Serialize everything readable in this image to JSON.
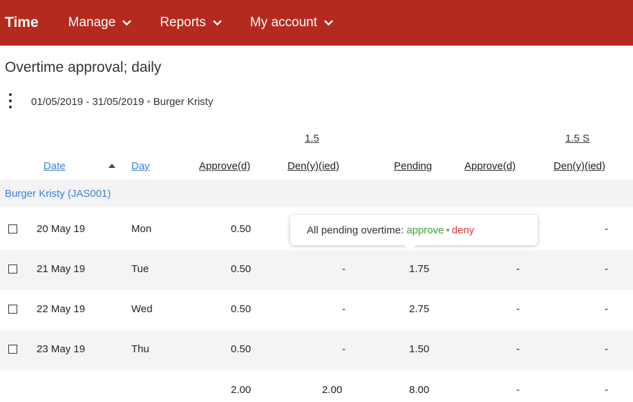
{
  "nav": {
    "brand": "Time",
    "items": [
      {
        "label": "Manage"
      },
      {
        "label": "Reports"
      },
      {
        "label": "My account"
      }
    ]
  },
  "page": {
    "title": "Overtime approval; daily",
    "date_range": "01/05/2019 - 31/05/2019",
    "person": "Burger Kristy"
  },
  "table": {
    "groups": [
      "1.5",
      "1.5 S"
    ],
    "columns": {
      "date": "Date",
      "day": "Day",
      "approve1": "Approve(d)",
      "deny1": "Den(y)(ied)",
      "pending": "Pending",
      "approve2": "Approve(d)",
      "deny2": "Den(y)(ied)"
    },
    "group_label": "Burger Kristy (JAS001)",
    "rows": [
      {
        "date": "20 May 19",
        "day": "Mon",
        "approve1": "0.50",
        "deny1": "",
        "pending": "",
        "approve2": "",
        "deny2": "-"
      },
      {
        "date": "21 May 19",
        "day": "Tue",
        "approve1": "0.50",
        "deny1": "-",
        "pending": "1.75",
        "approve2": "-",
        "deny2": "-"
      },
      {
        "date": "22 May 19",
        "day": "Wed",
        "approve1": "0.50",
        "deny1": "-",
        "pending": "2.75",
        "approve2": "-",
        "deny2": "-"
      },
      {
        "date": "23 May 19",
        "day": "Thu",
        "approve1": "0.50",
        "deny1": "-",
        "pending": "1.50",
        "approve2": "-",
        "deny2": "-"
      }
    ],
    "totals": {
      "approve1": "2.00",
      "deny1": "2.00",
      "pending": "8.00",
      "approve2": "-",
      "deny2": "-"
    }
  },
  "tooltip": {
    "text": "All pending overtime:",
    "approve": "approve",
    "separator": "•",
    "deny": "deny"
  }
}
